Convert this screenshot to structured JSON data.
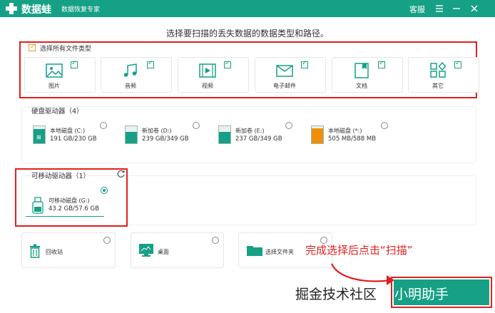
{
  "titlebar": {
    "app_name": "数据蛙",
    "app_subtitle": "数据恢复专家",
    "service_label": "客服"
  },
  "heading": "选择要扫描的丢失数据的数据类型和路径。",
  "file_types": {
    "select_all_label": "选择所有文件类型",
    "select_all_checked": true,
    "items": [
      {
        "label": "图片",
        "icon": "image-icon",
        "checked": true
      },
      {
        "label": "音频",
        "icon": "music-icon",
        "checked": true
      },
      {
        "label": "视频",
        "icon": "video-icon",
        "checked": true
      },
      {
        "label": "电子邮件",
        "icon": "email-icon",
        "checked": true
      },
      {
        "label": "文档",
        "icon": "document-icon",
        "checked": true
      },
      {
        "label": "其它",
        "icon": "other-icon",
        "checked": true
      }
    ]
  },
  "hard_drives": {
    "title": "硬盘驱动器（4）",
    "items": [
      {
        "name": "本地磁盘 (C:)",
        "size": "191 GB/230 GB",
        "used_fraction": 0.83,
        "color": "#16a085"
      },
      {
        "name": "新加卷 (D:)",
        "size": "239 GB/349 GB",
        "used_fraction": 0.68,
        "color": "#16a085"
      },
      {
        "name": "新加卷 (E:)",
        "size": "237 GB/349 GB",
        "used_fraction": 0.68,
        "color": "#16a085"
      },
      {
        "name": "本地磁盘 (*:)",
        "size": "505 MB/588 MB",
        "used_fraction": 0.86,
        "color": "#f0900a"
      }
    ]
  },
  "removable_drives": {
    "title": "可移动驱动器（1）",
    "items": [
      {
        "name": "可移动磁盘 (G:)",
        "size": "43.2 GB/57.6 GB",
        "selected": true
      }
    ]
  },
  "locations": [
    {
      "label": "回收站",
      "icon": "recycle-bin-icon"
    },
    {
      "label": "桌面",
      "icon": "desktop-icon"
    },
    {
      "label": "选择文件夹",
      "icon": "folder-icon"
    }
  ],
  "annotation": "完成选择后点击“扫描”",
  "watermark": {
    "prefix": "掘金技术社区",
    "user": "@ 小明助手"
  },
  "colors": {
    "accent": "#16a085",
    "highlight": "#e02020",
    "warning": "#f0900a"
  }
}
